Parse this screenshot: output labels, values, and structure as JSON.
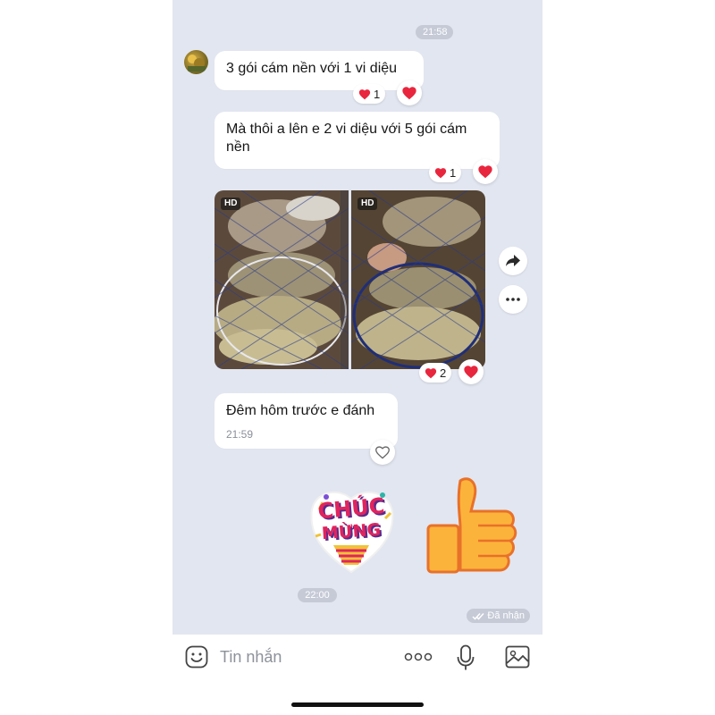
{
  "messages": {
    "time_1": "21:58",
    "msg_1": "3 gói cám nền với 1 vi diệu",
    "msg_1_reaction_count": "1",
    "msg_2": "Mà thôi a lên e 2 vi diệu với 5 gói cám nền",
    "msg_2_reaction_count": "1",
    "photos_hd_label": "HD",
    "photos_reaction_count": "2",
    "msg_3": "Đêm hôm trước e đánh",
    "msg_3_time": "21:59",
    "sticker_text_line1": "CHÚC",
    "sticker_text_line2": "MỪNG",
    "time_2": "22:00",
    "status": "Đã nhận"
  },
  "input": {
    "placeholder": "Tin nhắn"
  },
  "icons": {
    "reaction": "heart-icon",
    "forward": "share-arrow-icon",
    "more": "more-dots-icon",
    "emoji": "emoji-icon",
    "mic": "microphone-icon",
    "gallery": "image-icon",
    "check": "double-check-icon"
  },
  "colors": {
    "chat_background": "#e2e6f0",
    "heart": "#e8263d",
    "pill": "#c5cad6"
  }
}
